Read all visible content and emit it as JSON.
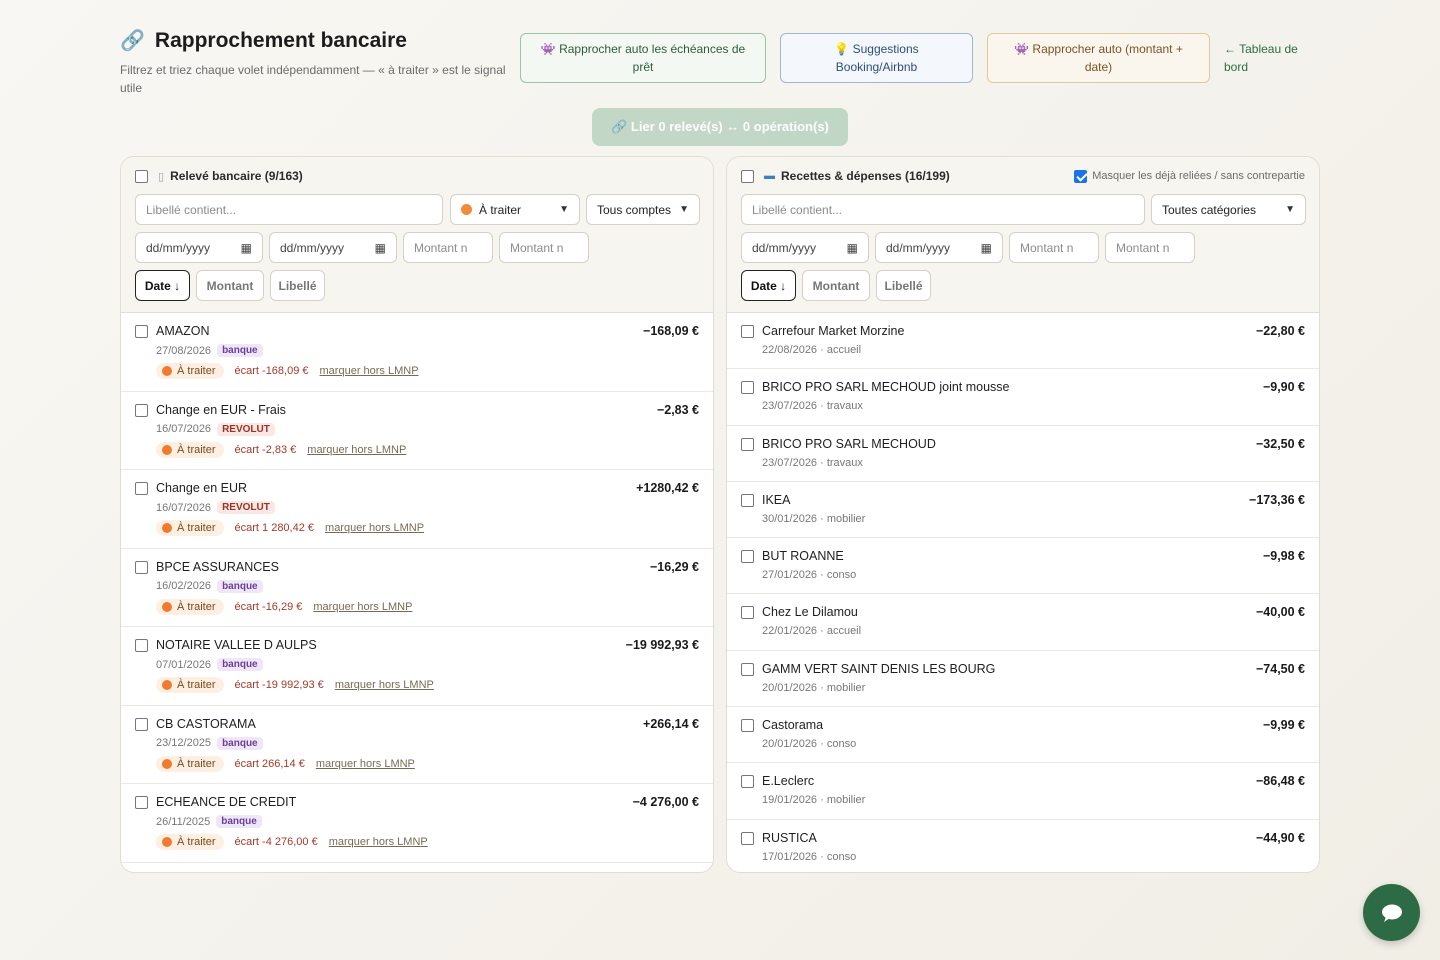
{
  "header": {
    "title": "Rapprochement bancaire",
    "title_icon": "link-icon",
    "subtitle": "Filtrez et triez chaque volet indépendamment — « à traiter » est le signal utile"
  },
  "actions": {
    "auto_loans": "👾 Rapprocher auto les échéances de prêt",
    "suggestions": "💡 Suggestions Booking/Airbnb",
    "auto_amount_date": "👾 Rapprocher auto (montant + date)",
    "dashboard_link": "← Tableau de bord",
    "link_button": "🔗 Lier 0 relevé(s) ↔ 0 opération(s)"
  },
  "left": {
    "title": "Relevé bancaire (9/163)",
    "icon": "document-icon",
    "label_placeholder": "Libellé contient...",
    "status_filter": "À traiter",
    "account_filter": "Tous comptes",
    "date_from": "dd/mm/yyyy",
    "date_to": "dd/mm/yyyy",
    "amount_min": "Montant n",
    "amount_max": "Montant n",
    "sort": {
      "date": "Date ↓",
      "amount": "Montant",
      "label": "Libellé"
    },
    "rows": [
      {
        "name": "AMAZON",
        "amount": "−168,09 €",
        "date": "27/08/2026",
        "tag": "banque",
        "status": "À traiter",
        "ecart": "écart -168,09 €",
        "mark": "marquer hors LMNP"
      },
      {
        "name": "Change en EUR - Frais",
        "amount": "−2,83 €",
        "date": "16/07/2026",
        "tag": "REVOLUT",
        "status": "À traiter",
        "ecart": "écart -2,83 €",
        "mark": "marquer hors LMNP"
      },
      {
        "name": "Change en EUR",
        "amount": "+1280,42 €",
        "date": "16/07/2026",
        "tag": "REVOLUT",
        "status": "À traiter",
        "ecart": "écart 1 280,42 €",
        "mark": "marquer hors LMNP"
      },
      {
        "name": "BPCE ASSURANCES",
        "amount": "−16,29 €",
        "date": "16/02/2026",
        "tag": "banque",
        "status": "À traiter",
        "ecart": "écart -16,29 €",
        "mark": "marquer hors LMNP"
      },
      {
        "name": "NOTAIRE VALLEE D AULPS",
        "amount": "−19 992,93 €",
        "date": "07/01/2026",
        "tag": "banque",
        "status": "À traiter",
        "ecart": "écart -19 992,93 €",
        "mark": "marquer hors LMNP"
      },
      {
        "name": "CB CASTORAMA",
        "amount": "+266,14 €",
        "date": "23/12/2025",
        "tag": "banque",
        "status": "À traiter",
        "ecart": "écart 266,14 €",
        "mark": "marquer hors LMNP"
      },
      {
        "name": "ECHEANCE DE CREDIT",
        "amount": "−4 276,00 €",
        "date": "26/11/2025",
        "tag": "banque",
        "status": "À traiter",
        "ecart": "écart -4 276,00 €",
        "mark": "marquer hors LMNP"
      }
    ]
  },
  "right": {
    "title": "Recettes & dépenses (16/199)",
    "icon": "credit-card-icon",
    "hide_linked_label": "Masquer les déjà reliées / sans contrepartie",
    "hide_linked_checked": true,
    "label_placeholder": "Libellé contient...",
    "category_filter": "Toutes catégories",
    "date_from": "dd/mm/yyyy",
    "date_to": "dd/mm/yyyy",
    "amount_min": "Montant n",
    "amount_max": "Montant n",
    "sort": {
      "date": "Date ↓",
      "amount": "Montant",
      "label": "Libellé"
    },
    "rows": [
      {
        "name": "Carrefour Market Morzine",
        "amount": "−22,80 €",
        "meta": "22/08/2026 · accueil"
      },
      {
        "name": "BRICO PRO SARL MECHOUD joint mousse",
        "amount": "−9,90 €",
        "meta": "23/07/2026 · travaux"
      },
      {
        "name": "BRICO PRO SARL MECHOUD",
        "amount": "−32,50 €",
        "meta": "23/07/2026 · travaux"
      },
      {
        "name": "IKEA",
        "amount": "−173,36 €",
        "meta": "30/01/2026 · mobilier"
      },
      {
        "name": "BUT ROANNE",
        "amount": "−9,98 €",
        "meta": "27/01/2026 · conso"
      },
      {
        "name": "Chez Le Dilamou",
        "amount": "−40,00 €",
        "meta": "22/01/2026 · accueil"
      },
      {
        "name": "GAMM VERT SAINT DENIS LES BOURG",
        "amount": "−74,50 €",
        "meta": "20/01/2026 · mobilier"
      },
      {
        "name": "Castorama",
        "amount": "−9,99 €",
        "meta": "20/01/2026 · conso"
      },
      {
        "name": "E.Leclerc",
        "amount": "−86,48 €",
        "meta": "19/01/2026 · mobilier"
      },
      {
        "name": "RUSTICA",
        "amount": "−44,90 €",
        "meta": "17/01/2026 · conso"
      }
    ]
  },
  "colors": {
    "accent": "#2d6b45",
    "status_dot": "#f07a2e",
    "tag_banque": "#6a3f99",
    "tag_revolut": "#9a3226"
  },
  "chat": {
    "icon": "chat-bubble-icon"
  }
}
